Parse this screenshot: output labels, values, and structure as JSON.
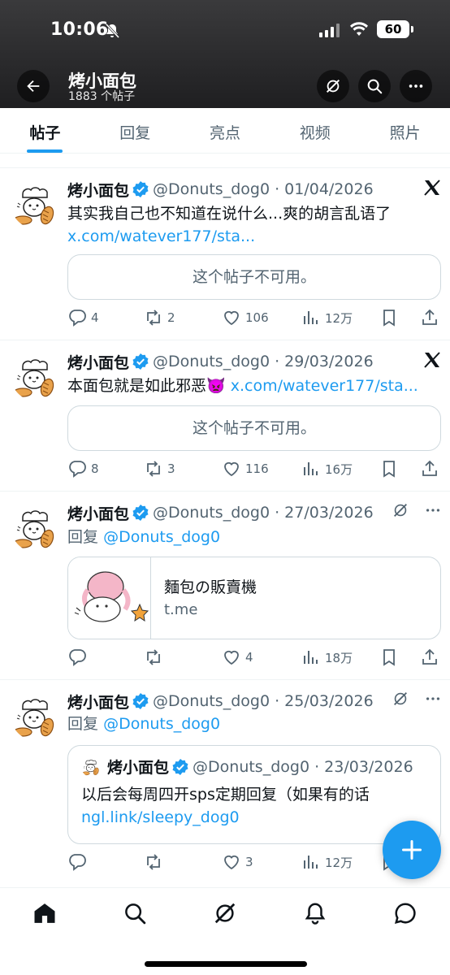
{
  "status_bar": {
    "time": "10:06",
    "battery": "60"
  },
  "header": {
    "name": "烤小面包",
    "post_count": "1883 个帖子"
  },
  "tabs": [
    {
      "label": "帖子",
      "active": true
    },
    {
      "label": "回复",
      "active": false
    },
    {
      "label": "亮点",
      "active": false
    },
    {
      "label": "视频",
      "active": false
    },
    {
      "label": "照片",
      "active": false
    }
  ],
  "posts": [
    {
      "name": "烤小面包",
      "handle": "@Donuts_dog0 · 01/04/2026",
      "text": "其实我自己也不知道在说什么...爽的胡言乱语了",
      "link": "x.com/watever177/sta...",
      "unavailable": "这个帖子不可用。",
      "replies": "4",
      "reposts": "2",
      "likes": "106",
      "views": "12万"
    },
    {
      "name": "烤小面包",
      "handle": "@Donuts_dog0 · 29/03/2026",
      "text": "本面包就是如此邪恶",
      "emoji": "👿",
      "link": "x.com/watever177/sta...",
      "unavailable": "这个帖子不可用。",
      "replies": "8",
      "reposts": "3",
      "likes": "116",
      "views": "16万"
    },
    {
      "name": "烤小面包",
      "handle": "@Donuts_dog0 · 27/03/2026",
      "reply_prefix": "回复",
      "reply_to": "@Donuts_dog0",
      "card_title": "麵包の販賣機",
      "card_domain": "t.me",
      "replies": "",
      "reposts": "",
      "likes": "4",
      "views": "18万"
    },
    {
      "name": "烤小面包",
      "handle": "@Donuts_dog0 · 25/03/2026",
      "reply_prefix": "回复",
      "reply_to": "@Donuts_dog0",
      "quote": {
        "name": "烤小面包",
        "handle": "@Donuts_dog0 · 23/03/2026",
        "text": "以后会每周四开sps定期回复（如果有的话",
        "link": "ngl.link/sleepy_dog0"
      },
      "replies": "",
      "reposts": "",
      "likes": "3",
      "views": "12万"
    }
  ],
  "colors": {
    "accent": "#1d9bf0",
    "secondary_text": "#536471",
    "border": "#cfd9de"
  }
}
